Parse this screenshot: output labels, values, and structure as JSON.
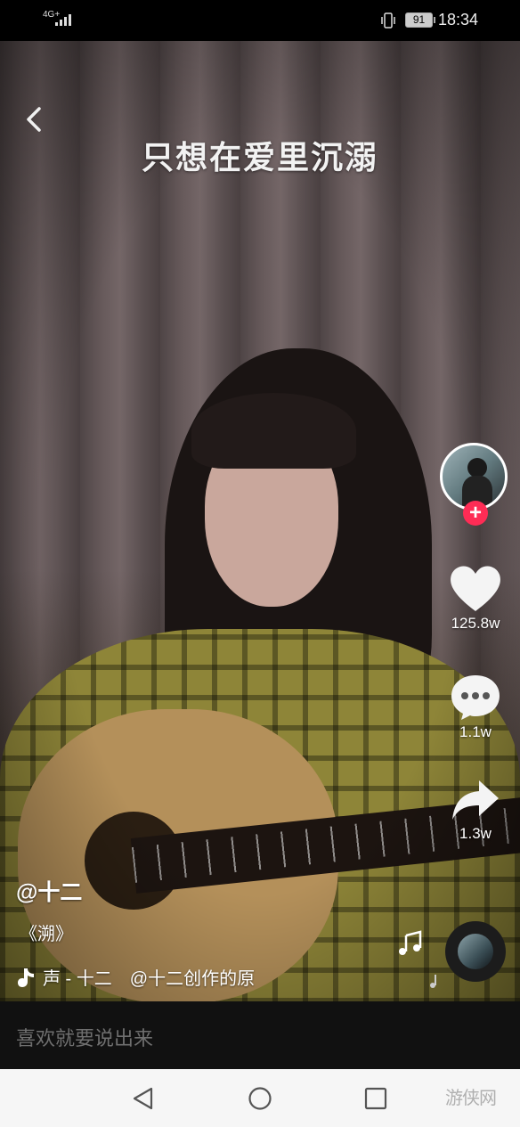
{
  "status_bar": {
    "network": "4G+",
    "battery": "91",
    "time": "18:34"
  },
  "video": {
    "lyric": "只想在爱里沉溺"
  },
  "actions": {
    "like_count": "125.8w",
    "comment_count": "1.1w",
    "share_count": "1.3w"
  },
  "post": {
    "username": "@十二",
    "caption": "《溯》",
    "music": "声 - 十二　@十二创作的原"
  },
  "comment": {
    "placeholder": "喜欢就要说出来"
  },
  "watermark": "游侠网",
  "colors": {
    "follow_accent": "#fe2c55",
    "nav_background": "#f6f6f6",
    "comment_bar": "#111111"
  },
  "icons": [
    "back-arrow-icon",
    "heart-icon",
    "comment-bubble-icon",
    "share-arrow-icon",
    "music-note-icon",
    "nav-back-icon",
    "nav-home-icon",
    "nav-recent-icon"
  ]
}
